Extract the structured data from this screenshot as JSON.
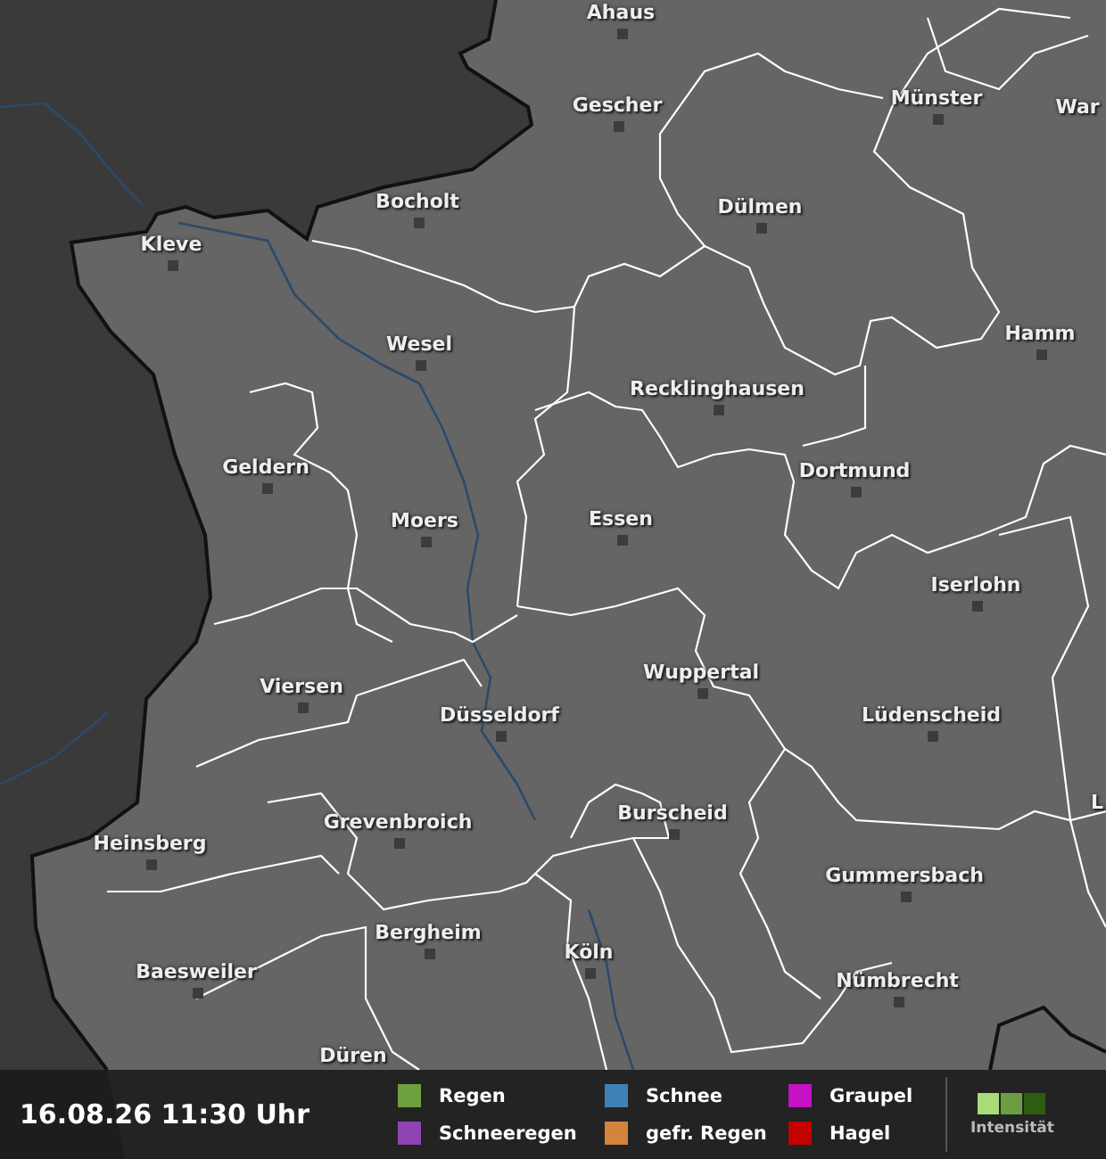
{
  "map": {
    "cities": [
      {
        "name": "Ahaus",
        "marker": true
      },
      {
        "name": "Gescher",
        "marker": true
      },
      {
        "name": "Münster",
        "marker": true
      },
      {
        "name": "War",
        "marker": false
      },
      {
        "name": "Bocholt",
        "marker": true
      },
      {
        "name": "Dülmen",
        "marker": true
      },
      {
        "name": "Kleve",
        "marker": true
      },
      {
        "name": "Wesel",
        "marker": true
      },
      {
        "name": "Hamm",
        "marker": true
      },
      {
        "name": "Recklinghausen",
        "marker": true
      },
      {
        "name": "Geldern",
        "marker": true
      },
      {
        "name": "Dortmund",
        "marker": true
      },
      {
        "name": "Moers",
        "marker": true
      },
      {
        "name": "Essen",
        "marker": true
      },
      {
        "name": "Iserlohn",
        "marker": true
      },
      {
        "name": "Wuppertal",
        "marker": true
      },
      {
        "name": "Viersen",
        "marker": true
      },
      {
        "name": "Düsseldorf",
        "marker": true
      },
      {
        "name": "Lüdenscheid",
        "marker": true
      },
      {
        "name": "L",
        "marker": false
      },
      {
        "name": "Burscheid",
        "marker": true
      },
      {
        "name": "Grevenbroich",
        "marker": true
      },
      {
        "name": "Heinsberg",
        "marker": true
      },
      {
        "name": "Gummersbach",
        "marker": true
      },
      {
        "name": "Bergheim",
        "marker": true
      },
      {
        "name": "Köln",
        "marker": true
      },
      {
        "name": "Baesweiler",
        "marker": true
      },
      {
        "name": "Nümbrecht",
        "marker": true
      },
      {
        "name": "Düren",
        "marker": false
      }
    ]
  },
  "footer": {
    "timestamp": "16.08.26 11:30 Uhr",
    "legend": [
      {
        "label": "Regen",
        "color": "#6fa040"
      },
      {
        "label": "Schneeregen",
        "color": "#9044b4"
      },
      {
        "label": "Schnee",
        "color": "#3c82b8"
      },
      {
        "label": "gefr. Regen",
        "color": "#d4843c"
      },
      {
        "label": "Graupel",
        "color": "#c412c4"
      },
      {
        "label": "Hagel",
        "color": "#c40000"
      }
    ],
    "intensity": {
      "label": "Intensität",
      "steps": [
        {
          "color": "#a8dc78"
        },
        {
          "color": "#6c9c44"
        },
        {
          "color": "#2e5c12"
        }
      ]
    }
  }
}
